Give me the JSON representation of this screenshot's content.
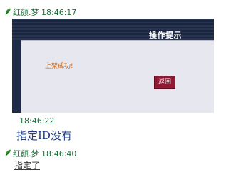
{
  "messages": [
    {
      "sender": "红颜.梦",
      "time": "18:46:17"
    },
    {
      "time": "18:46:22",
      "text": "指定ID没有"
    },
    {
      "sender": "红颜.梦",
      "time": "18:46:40",
      "text": "指定了"
    }
  ],
  "screenshot": {
    "dialog_title": "操作提示",
    "message": "上架成功!",
    "back_button": "返回"
  },
  "icons": {
    "sender": "leaf-icon"
  },
  "colors": {
    "dialog_bg": "#1d2a48",
    "frame_bg": "#e7e8ef",
    "button": "#8e1a36",
    "status_text": "#c8661c",
    "sender_green": "#1d6e3a",
    "message_blue": "#1f3d8c"
  }
}
